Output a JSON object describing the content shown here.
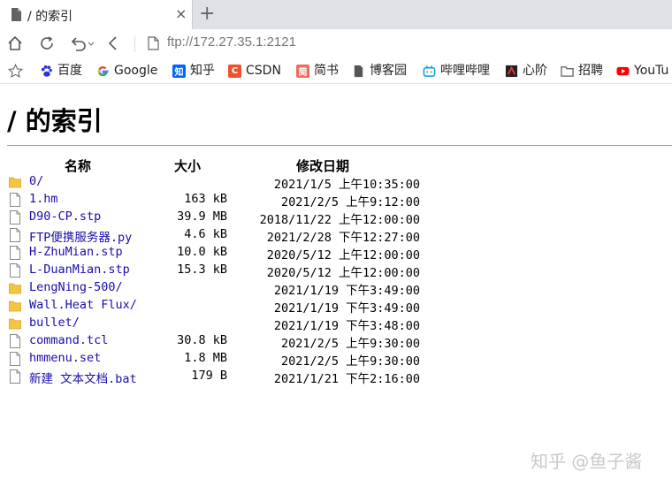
{
  "browser": {
    "tab_title": "/ 的索引",
    "tab_close": "×",
    "new_tab": "+",
    "url": "ftp://172.27.35.1:2121"
  },
  "bookmarks": [
    {
      "label": "百度",
      "icon": "baidu-paw-icon",
      "color": "#2932e1"
    },
    {
      "label": "Google",
      "icon": "google-icon",
      "color": "#4285f4"
    },
    {
      "label": "知乎",
      "icon": "zhihu-icon",
      "color": "#0066ff",
      "glyph": "知"
    },
    {
      "label": "CSDN",
      "icon": "csdn-icon",
      "color": "#f0522d",
      "glyph": "C"
    },
    {
      "label": "简书",
      "icon": "jianshu-icon",
      "color": "#ea6f5a",
      "glyph": "简"
    },
    {
      "label": "博客园",
      "icon": "page-icon",
      "color": "#555555"
    },
    {
      "label": "哔哩哔哩",
      "icon": "bilibili-icon",
      "color": "#00a1d6"
    },
    {
      "label": "心阶",
      "icon": "xinjie-icon",
      "color": "#b22222"
    },
    {
      "label": "招聘",
      "icon": "folder-icon",
      "color": "#777777"
    },
    {
      "label": "YouTu",
      "icon": "youtube-icon",
      "color": "#ff0000"
    }
  ],
  "page": {
    "title": "/ 的索引",
    "columns": {
      "name": "名称",
      "size": "大小",
      "date": "修改日期"
    },
    "files": [
      {
        "type": "folder",
        "name": "0/",
        "size": "",
        "date": "2021/1/5 上午10:35:00"
      },
      {
        "type": "file",
        "name": "1.hm",
        "size": "163 kB",
        "date": "2021/2/5 上午9:12:00"
      },
      {
        "type": "file",
        "name": "D90-CP.stp",
        "size": "39.9 MB",
        "date": "2018/11/22 上午12:00:00"
      },
      {
        "type": "file",
        "name": "FTP便携服务器.py",
        "size": "4.6 kB",
        "date": "2021/2/28 下午12:27:00"
      },
      {
        "type": "file",
        "name": "H-ZhuMian.stp",
        "size": "10.0 kB",
        "date": "2020/5/12 上午12:00:00"
      },
      {
        "type": "file",
        "name": "L-DuanMian.stp",
        "size": "15.3 kB",
        "date": "2020/5/12 上午12:00:00"
      },
      {
        "type": "folder",
        "name": "LengNing-500/",
        "size": "",
        "date": "2021/1/19 下午3:49:00"
      },
      {
        "type": "folder",
        "name": "Wall.Heat Flux/",
        "size": "",
        "date": "2021/1/19 下午3:49:00"
      },
      {
        "type": "folder",
        "name": "bullet/",
        "size": "",
        "date": "2021/1/19 下午3:48:00"
      },
      {
        "type": "file",
        "name": "command.tcl",
        "size": "30.8 kB",
        "date": "2021/2/5 上午9:30:00"
      },
      {
        "type": "file",
        "name": "hmmenu.set",
        "size": "1.8 MB",
        "date": "2021/2/5 上午9:30:00"
      },
      {
        "type": "file",
        "name": "新建 文本文档.bat",
        "size": "179 B",
        "date": "2021/1/21 下午2:16:00"
      }
    ]
  },
  "watermark": "知乎 @鱼子酱"
}
